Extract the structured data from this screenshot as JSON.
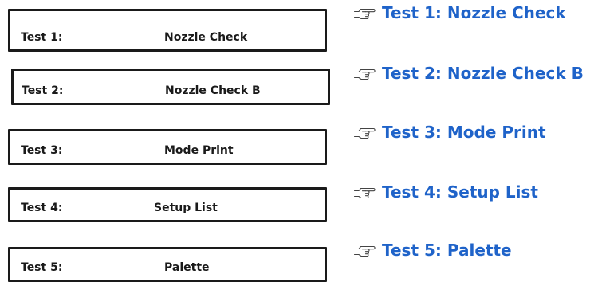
{
  "panels": [
    {
      "test": "Test 1:",
      "name": "Nozzle Check"
    },
    {
      "test": "Test 2:",
      "name": "Nozzle Check B"
    },
    {
      "test": "Test 3:",
      "name": "Mode Print"
    },
    {
      "test": "Test 4:",
      "name": "Setup List"
    },
    {
      "test": "Test 5:",
      "name": "Palette"
    }
  ],
  "references": [
    {
      "label": "Test 1: Nozzle Check",
      "icon": "pointing-hand-icon"
    },
    {
      "label": "Test 2: Nozzle Check B",
      "icon": "pointing-hand-icon"
    },
    {
      "label": "Test 3: Mode Print",
      "icon": "pointing-hand-icon"
    },
    {
      "label": "Test 4: Setup List",
      "icon": "pointing-hand-icon"
    },
    {
      "label": "Test 5: Palette",
      "icon": "pointing-hand-icon"
    }
  ],
  "colors": {
    "link": "#1f63c9",
    "frame": "#1a1a1a"
  }
}
